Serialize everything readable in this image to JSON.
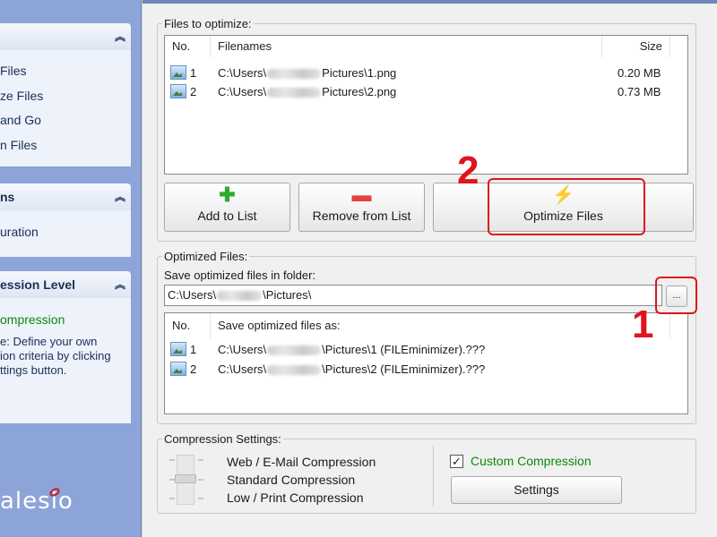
{
  "sidebar": {
    "panel1": {
      "items": [
        "Files",
        "ze Files",
        "and Go",
        "n Files"
      ]
    },
    "panel2": {
      "title": "ns",
      "items": [
        "uration"
      ]
    },
    "panel3": {
      "title": "ession Level",
      "mode": "ompression",
      "description": [
        "e: Define your own",
        "ion criteria by clicking",
        "ttings button."
      ]
    },
    "logo": "alesio"
  },
  "files_group": {
    "legend": "Files to optimize:",
    "columns": {
      "no": "No.",
      "filenames": "Filenames",
      "size": "Size"
    },
    "rows": [
      {
        "no": "1",
        "path_prefix": "C:\\Users\\",
        "path_suffix": "Pictures\\1.png",
        "size": "0.20 MB"
      },
      {
        "no": "2",
        "path_prefix": "C:\\Users\\",
        "path_suffix": "Pictures\\2.png",
        "size": "0.73 MB"
      }
    ]
  },
  "buttons": {
    "add": "Add to List",
    "remove": "Remove from List",
    "optimize": "Optimize Files"
  },
  "optimized_group": {
    "legend": "Optimized Files:",
    "folder_label": "Save optimized files in folder:",
    "folder_prefix": "C:\\Users\\",
    "folder_suffix": "\\Pictures\\",
    "browse": "...",
    "columns": {
      "no": "No.",
      "save_as": "Save optimized files as:"
    },
    "rows": [
      {
        "no": "1",
        "path_prefix": "C:\\Users\\",
        "path_suffix": "\\Pictures\\1 (FILEminimizer).???"
      },
      {
        "no": "2",
        "path_prefix": "C:\\Users\\",
        "path_suffix": "\\Pictures\\2 (FILEminimizer).???"
      }
    ]
  },
  "compression_group": {
    "legend": "Compression Settings:",
    "levels": [
      "Web / E-Mail Compression",
      "Standard Compression",
      "Low / Print Compression"
    ],
    "custom_label": "Custom Compression",
    "custom_checked": true,
    "checkmark": "✓",
    "settings_button": "Settings"
  },
  "annotations": {
    "one": "1",
    "two": "2"
  },
  "colors": {
    "accent_red": "#e0141e",
    "custom_green": "#0a8a0a",
    "sidebar_blue": "#8ca4d8"
  }
}
